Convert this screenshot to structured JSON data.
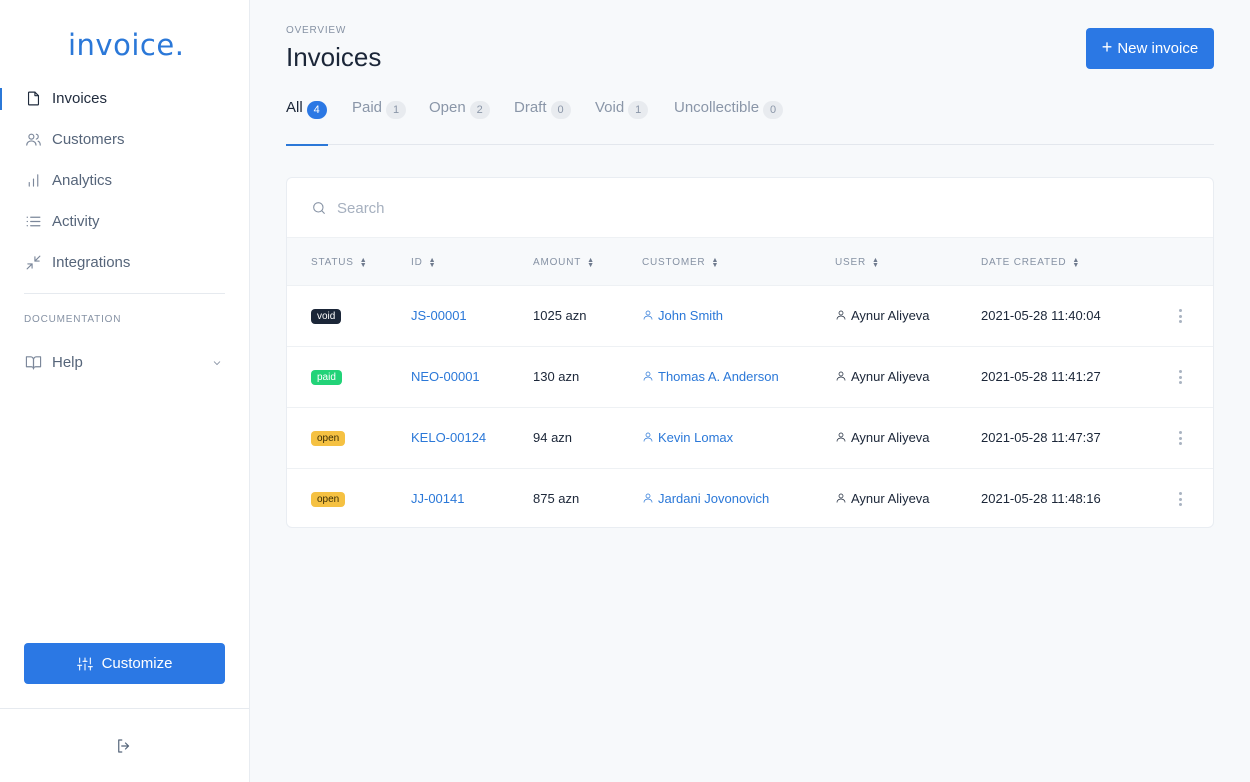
{
  "brand": {
    "name": "invoice",
    "dot": "."
  },
  "sidebar": {
    "items": [
      {
        "label": "Invoices",
        "icon": "file-icon",
        "active": true
      },
      {
        "label": "Customers",
        "icon": "users-icon",
        "active": false
      },
      {
        "label": "Analytics",
        "icon": "bar-chart-icon",
        "active": false
      },
      {
        "label": "Activity",
        "icon": "list-icon",
        "active": false
      },
      {
        "label": "Integrations",
        "icon": "minimize-icon",
        "active": false
      }
    ],
    "documentation_label": "DOCUMENTATION",
    "help_label": "Help",
    "customize_label": "Customize"
  },
  "header": {
    "overline": "OVERVIEW",
    "title": "Invoices",
    "new_button": "New invoice",
    "new_button_icon": "+"
  },
  "tabs": [
    {
      "label": "All",
      "count": "4",
      "active": true
    },
    {
      "label": "Paid",
      "count": "1",
      "active": false
    },
    {
      "label": "Open",
      "count": "2",
      "active": false
    },
    {
      "label": "Draft",
      "count": "0",
      "active": false
    },
    {
      "label": "Void",
      "count": "1",
      "active": false
    },
    {
      "label": "Uncollectible",
      "count": "0",
      "active": false
    }
  ],
  "search": {
    "placeholder": "Search",
    "value": ""
  },
  "table": {
    "columns": [
      "STATUS",
      "ID",
      "AMOUNT",
      "CUSTOMER",
      "USER",
      "DATE CREATED"
    ],
    "rows": [
      {
        "status": "void",
        "id": "JS-00001",
        "amount": "1025 azn",
        "customer": "John Smith",
        "user": "Aynur Aliyeva",
        "date": "2021-05-28 11:40:04"
      },
      {
        "status": "paid",
        "id": "NEO-00001",
        "amount": "130 azn",
        "customer": "Thomas A. Anderson",
        "user": "Aynur Aliyeva",
        "date": "2021-05-28 11:41:27"
      },
      {
        "status": "open",
        "id": "KELO-00124",
        "amount": "94 azn",
        "customer": "Kevin Lomax",
        "user": "Aynur Aliyeva",
        "date": "2021-05-28 11:47:37"
      },
      {
        "status": "open",
        "id": "JJ-00141",
        "amount": "875 azn",
        "customer": "Jardani Jovonovich",
        "user": "Aynur Aliyeva",
        "date": "2021-05-28 11:48:16"
      }
    ]
  },
  "colors": {
    "accent": "#2b78e4",
    "status_void": "#1b2638",
    "status_paid": "#22d378",
    "status_open": "#f5c142"
  }
}
